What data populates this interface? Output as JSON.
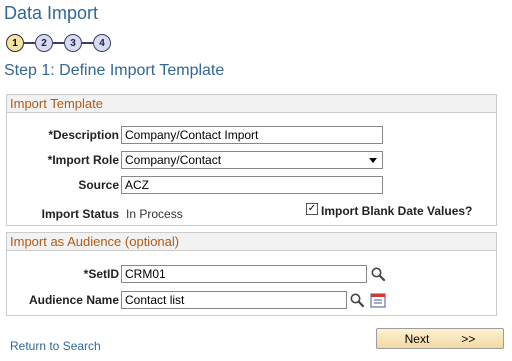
{
  "page": {
    "title": "Data Import",
    "step_title": "Step 1: Define Import Template"
  },
  "steps": [
    "1",
    "2",
    "3",
    "4"
  ],
  "import_template": {
    "header": "Import Template",
    "description_label": "*Description",
    "description_value": "Company/Contact Import",
    "import_role_label": "*Import Role",
    "import_role_value": "Company/Contact",
    "source_label": "Source",
    "source_value": "ACZ",
    "import_status_label": "Import Status",
    "import_status_value": "In Process",
    "blank_date_label": "Import Blank Date Values?",
    "blank_date_checked": true
  },
  "audience": {
    "header": "Import as Audience (optional)",
    "setid_label": "*SetID",
    "setid_value": "CRM01",
    "audience_name_label": "Audience Name",
    "audience_name_value": "Contact list"
  },
  "footer": {
    "return_link": "Return to Search",
    "next_label": "Next",
    "next_arrows": ">>"
  },
  "colors": {
    "title": "#336699",
    "group_header_text": "#b05a14",
    "active_step": "#f4e4a2"
  }
}
